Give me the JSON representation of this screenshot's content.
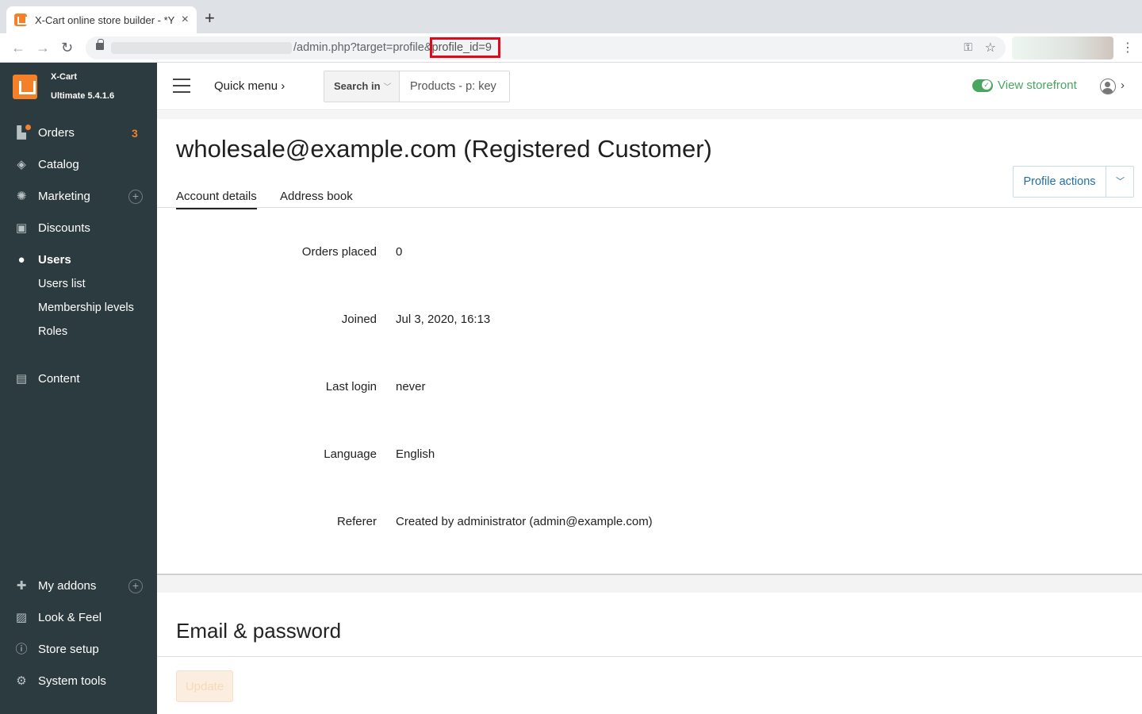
{
  "browser": {
    "tab_title": "X-Cart online store builder - *Y",
    "tab_close": "×",
    "new_tab": "+",
    "url_path": "/admin.php?target=profile&",
    "url_highlight": "profile_id=9",
    "back": "←",
    "forward": "→",
    "reload": "↻",
    "key": "⚿",
    "star": "☆",
    "menu": "⋮"
  },
  "brand": {
    "name": "X-Cart",
    "version": "Ultimate 5.4.1.6",
    "color": "#f4812a"
  },
  "sidebar": {
    "items": [
      {
        "label": "Orders",
        "icon": "orders-icon",
        "badge": "3"
      },
      {
        "label": "Catalog",
        "icon": "tag-icon"
      },
      {
        "label": "Marketing",
        "icon": "marketing-icon",
        "plus": "+"
      },
      {
        "label": "Discounts",
        "icon": "gift-icon"
      },
      {
        "label": "Users",
        "icon": "users-icon",
        "active": true
      },
      {
        "label": "Content",
        "icon": "content-icon"
      }
    ],
    "users_sub": [
      "Users list",
      "Membership levels",
      "Roles"
    ],
    "bottom": [
      {
        "label": "My addons",
        "icon": "puzzle-icon",
        "plus": "+"
      },
      {
        "label": "Look & Feel",
        "icon": "image-icon"
      },
      {
        "label": "Store setup",
        "icon": "info-icon"
      },
      {
        "label": "System tools",
        "icon": "gear-icon"
      }
    ]
  },
  "header": {
    "quick_menu": "Quick menu",
    "quick_menu_chev": "›",
    "search_in": "Search in",
    "search_placeholder": "Products - p: key",
    "view_storefront": "View storefront",
    "user_chev": "›"
  },
  "profile": {
    "title": "wholesale@example.com (Registered Customer)",
    "tabs": [
      "Account details",
      "Address book"
    ],
    "actions_label": "Profile actions",
    "fields": [
      {
        "label": "Orders placed",
        "value": "0"
      },
      {
        "label": "Joined",
        "value": "Jul 3, 2020, 16:13"
      },
      {
        "label": "Last login",
        "value": "never"
      },
      {
        "label": "Language",
        "value": "English"
      },
      {
        "label": "Referer",
        "value": "Created by administrator (admin@example.com)"
      }
    ],
    "section_title": "Email & password",
    "update_label": "Update"
  },
  "colors": {
    "sidebar_bg": "#2c3b3f",
    "accent": "#f4812a",
    "link": "#1f6fa8",
    "storefront_green": "#4aa561",
    "url_highlight_border": "#e0081a"
  }
}
